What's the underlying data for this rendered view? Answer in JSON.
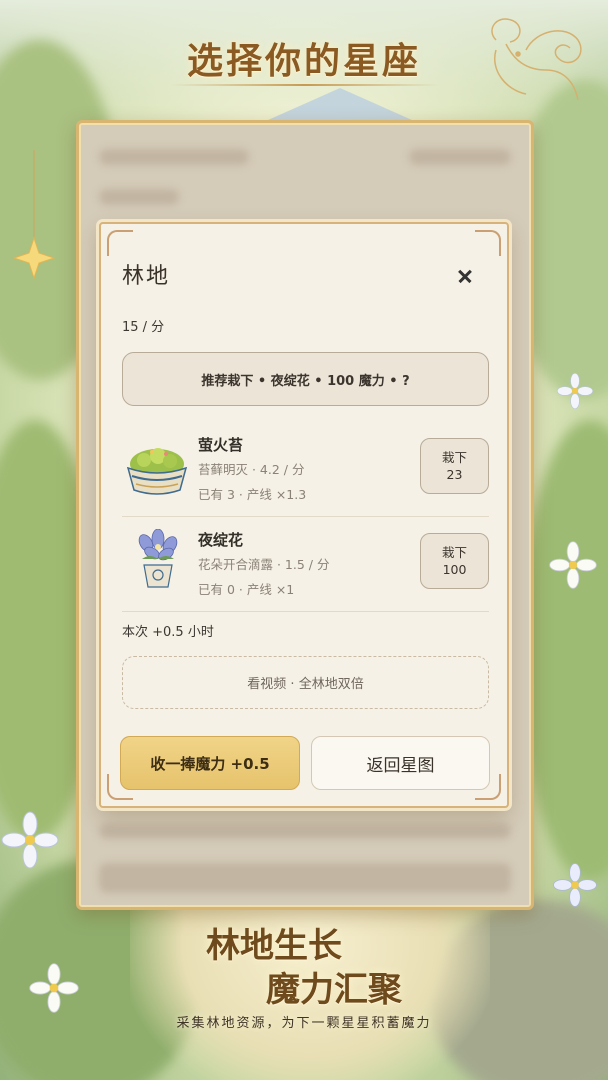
{
  "banner": {
    "top_heading": "选择你的星座",
    "bottom_heading_line1": "林地生长",
    "bottom_heading_line2": "魔力汇聚",
    "subtitle": "采集林地资源，为下一颗星星积蓄魔力"
  },
  "dialog": {
    "title": "林地",
    "rate": "15 / 分",
    "recommend_label": "推荐栽下 • 夜绽花 • 100 魔力 • ?",
    "plants": [
      {
        "name": "萤火苔",
        "desc": "苔藓明灭 · 4.2 / 分",
        "owned": "已有 3 · 产线 ×1.3",
        "btn_label": "栽下",
        "btn_cost": "23",
        "icon": "moss-bowl-icon"
      },
      {
        "name": "夜绽花",
        "desc": "花朵开合滴露 · 1.5 / 分",
        "owned": "已有 0 · 产线 ×1",
        "btn_label": "栽下",
        "btn_cost": "100",
        "icon": "flower-pot-icon"
      }
    ],
    "session": "本次 +0.5 小时",
    "video_label": "看视频 · 全林地双倍",
    "collect_label": "收一捧魔力 +0.5",
    "back_label": "返回星图"
  },
  "colors": {
    "accent_gold": "#e6c36c",
    "dialog_bg": "#f6f1e6",
    "frame_gold": "#d7b27a",
    "title_brown": "#8a5a22"
  }
}
